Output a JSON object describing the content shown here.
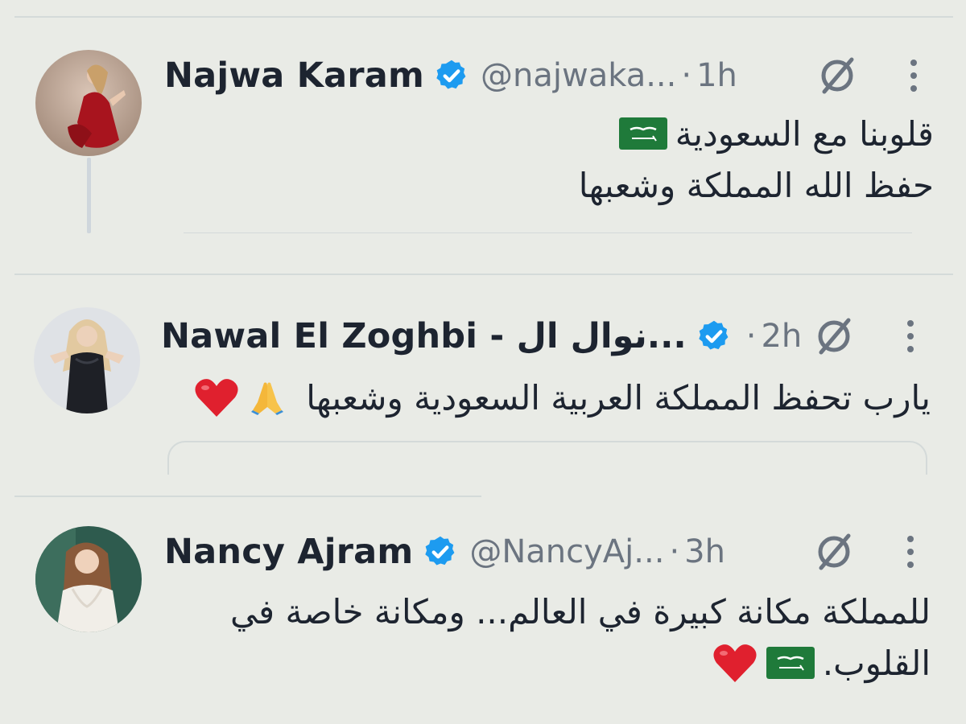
{
  "tweets": [
    {
      "name": "Najwa Karam",
      "handle": "@najwaka...",
      "separator": "·",
      "time": "1h",
      "lines": [
        "قلوبنا مع السعودية",
        "حفظ الله المملكة وشعبها"
      ],
      "icons": [
        "saudi-flag-emoji"
      ]
    },
    {
      "name": "Nawal El Zoghbi - نوال ال...",
      "handle": "",
      "separator": "·",
      "time": "2h",
      "lines": [
        "يارب تحفظ المملكة العربية السعودية وشعبها"
      ],
      "icons": [
        "folded-hands-emoji",
        "red-heart-emoji"
      ]
    },
    {
      "name": "Nancy Ajram",
      "handle": "@NancyAj...",
      "separator": "·",
      "time": "3h",
      "lines": [
        "للمملكة مكانة كبيرة في العالم... ومكانة خاصة في",
        "القلوب."
      ],
      "icons": [
        "saudi-flag-emoji",
        "red-heart-emoji"
      ]
    }
  ],
  "colors": {
    "background": "#e9ebe6",
    "text": "#1d2430",
    "muted": "#6b7480",
    "verified": "#1d9bf0",
    "flag_green": "#1f7a3a",
    "heart_red": "#e0202e"
  }
}
